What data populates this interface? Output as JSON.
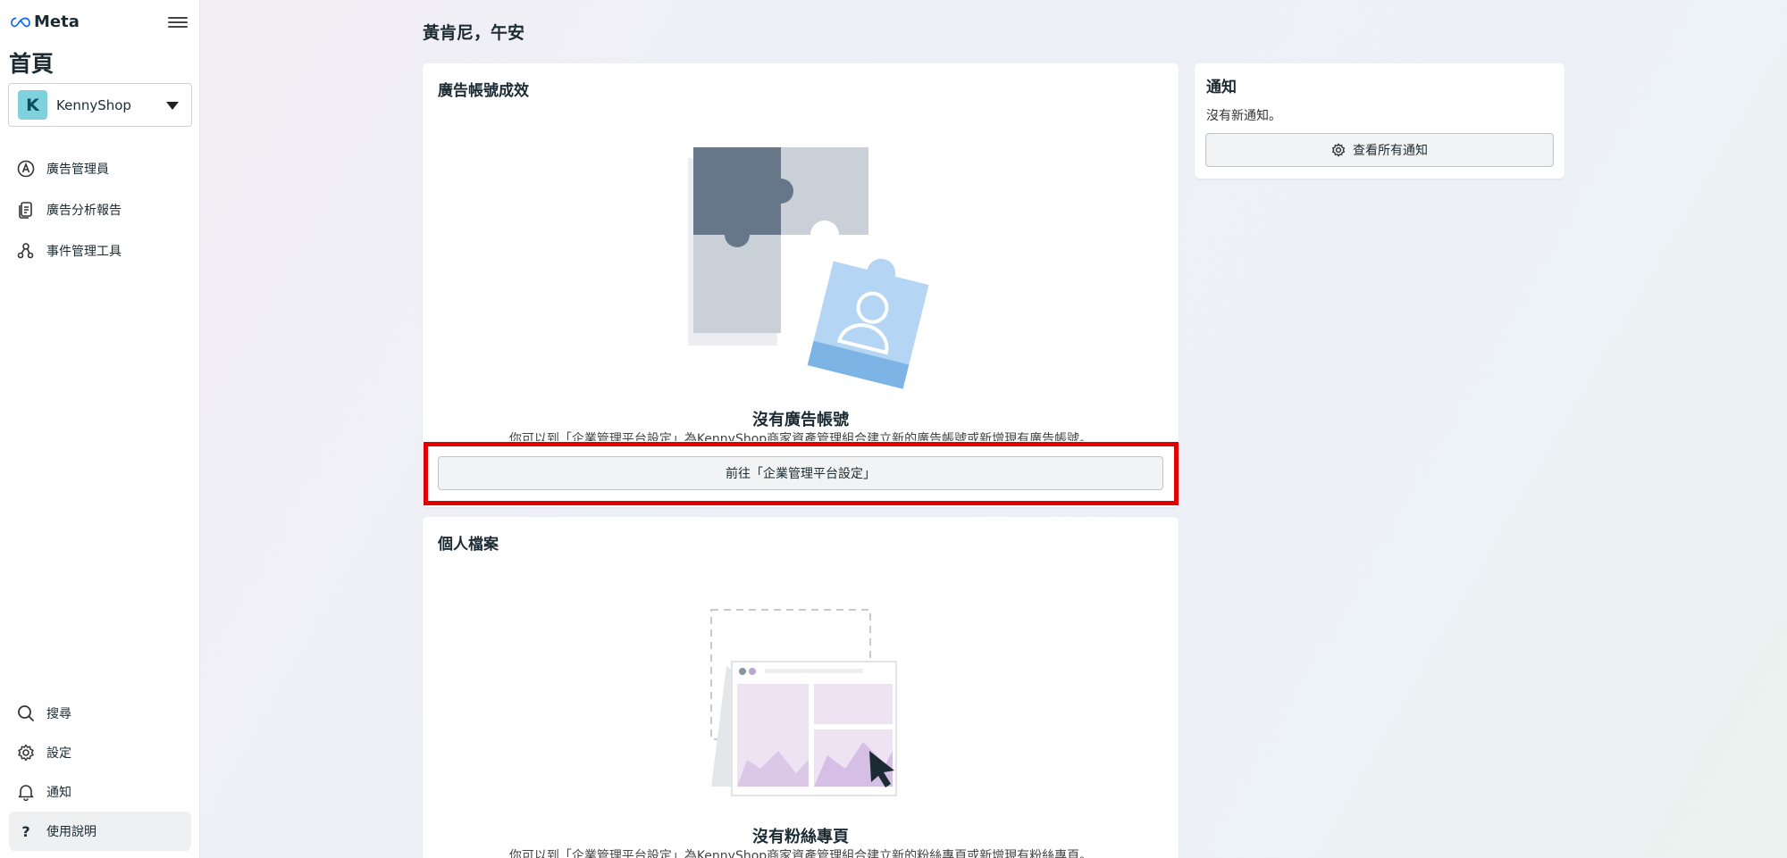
{
  "brand": {
    "name": "Meta"
  },
  "sidebar": {
    "heading": "首頁",
    "account": {
      "initial": "K",
      "name": "KennyShop"
    },
    "nav": [
      {
        "label": "廣告管理員",
        "icon": "ads-manager-icon"
      },
      {
        "label": "廣告分析報告",
        "icon": "report-icon"
      },
      {
        "label": "事件管理工具",
        "icon": "events-icon"
      }
    ],
    "bottom": [
      {
        "label": "搜尋",
        "icon": "search-icon"
      },
      {
        "label": "設定",
        "icon": "gear-icon"
      },
      {
        "label": "通知",
        "icon": "bell-icon"
      },
      {
        "label": "使用說明",
        "icon": "help-icon"
      }
    ]
  },
  "main": {
    "greeting": "黃肯尼，午安",
    "ads_card": {
      "title": "廣告帳號成效",
      "empty_title": "沒有廣告帳號",
      "empty_desc": "你可以到「企業管理平台設定」為KennyShop商家資產管理組合建立新的廣告帳號或新增現有廣告帳號。",
      "button": "前往「企業管理平台設定」"
    },
    "profile_card": {
      "title": "個人檔案",
      "empty_title": "沒有粉絲專頁",
      "empty_desc": "你可以到「企業管理平台設定」為KennyShop商家資產管理組合建立新的粉絲專頁或新增現有粉絲專頁。"
    },
    "notice_card": {
      "title": "通知",
      "empty": "沒有新通知。",
      "button": "查看所有通知"
    }
  },
  "colors": {
    "highlight": "#e00000",
    "avatar": "#7fd1dd"
  }
}
